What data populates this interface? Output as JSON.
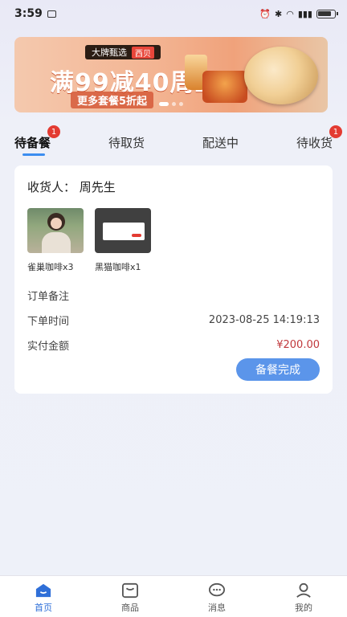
{
  "status_bar": {
    "time": "3:59",
    "battery": ""
  },
  "banner": {
    "brand": "大牌甄选",
    "brand_tag": "西贝",
    "promo": "满99减40周五",
    "sub": "更多套餐5折起"
  },
  "tabs": [
    {
      "label": "待备餐",
      "badge": "1",
      "active": true
    },
    {
      "label": "待取货",
      "badge": "",
      "active": false
    },
    {
      "label": "配送中",
      "badge": "",
      "active": false
    },
    {
      "label": "待收货",
      "badge": "1",
      "active": false
    }
  ],
  "order": {
    "recipient_label": "收货人：",
    "recipient_name": "周先生",
    "products": [
      {
        "name": "雀巢咖啡x3"
      },
      {
        "name": "黑猫咖啡x1"
      }
    ],
    "note_label": "订单备注",
    "time_label": "下单时间",
    "time_value": "2023-08-25 14:19:13",
    "amount_label": "实付金额",
    "amount_value": "¥200.00",
    "action_label": "备餐完成"
  },
  "bottom_nav": [
    {
      "label": "首页",
      "icon": "home-icon",
      "active": true
    },
    {
      "label": "商品",
      "icon": "goods-icon",
      "active": false
    },
    {
      "label": "消息",
      "icon": "message-icon",
      "active": false
    },
    {
      "label": "我的",
      "icon": "profile-icon",
      "active": false
    }
  ],
  "colors": {
    "accent": "#3c8df0",
    "badge": "#e33b32",
    "price": "#c0383c",
    "button": "#5b95ea"
  }
}
